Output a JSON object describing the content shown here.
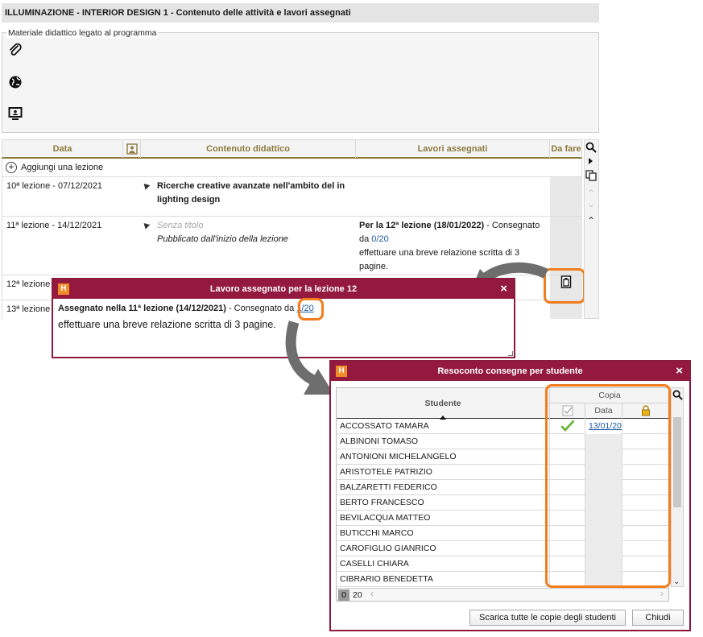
{
  "header": {
    "title": "ILLUMINAZIONE - INTERIOR DESIGN 1 - Contenuto delle attività e lavori assegnati"
  },
  "materials": {
    "legend": "Materiale didattico legato al programma",
    "icons": [
      "paperclip-icon",
      "globe-icon",
      "monitor-icon"
    ]
  },
  "table": {
    "columns": [
      "Data",
      "Contenuto didattico",
      "Lavori assegnati",
      "Da fare"
    ],
    "add_lesson": "Aggiungi una lezione",
    "rows": [
      {
        "date": "10ª lezione - 07/12/2021",
        "content_title": "Ricerche creative avanzate nell'ambito del in lighting design",
        "content_sub": "",
        "work_title": "",
        "work_delivered": "",
        "work_link": "",
        "work_text": ""
      },
      {
        "date": "11ª lezione - 14/12/2021",
        "content_title": "Senza titolo",
        "content_sub": "Pubblicato dall'inizio della lezione",
        "work_title": "Per la 12ª lezione (18/01/2022)",
        "work_delivered": " - Consegnato da ",
        "work_link": "0/20",
        "work_text": "effettuare una breve relazione scritta di 3 pagine."
      },
      {
        "date": "12ª lezione",
        "content_title": "",
        "content_sub": "",
        "work_title": "",
        "work_delivered": "",
        "work_link": "",
        "work_text": ""
      },
      {
        "date": "13ª lezione",
        "content_title": "",
        "content_sub": "",
        "work_title": "",
        "work_delivered": "",
        "work_link": "",
        "work_text": ""
      }
    ]
  },
  "dialog_assignment": {
    "title": "Lavoro assegnato per la lezione 12",
    "close": "×",
    "assigned": "Assegnato nella 11ª lezione (14/12/2021)",
    "delivered": " - Consegnato da ",
    "link": "1/20",
    "text": "effettuare una breve relazione scritta di 3 pagine."
  },
  "dialog_report": {
    "title": "Resoconto consegne per studente",
    "close": "×",
    "col_student": "Studente",
    "col_copy": "Copia",
    "col_date": "Data",
    "students": [
      {
        "name": "ACCOSSATO TAMARA",
        "delivered": true,
        "date": "13/01/20"
      },
      {
        "name": "ALBINONI TOMASO",
        "delivered": false,
        "date": ""
      },
      {
        "name": "ANTONIONI MICHELANGELO",
        "delivered": false,
        "date": ""
      },
      {
        "name": "ARISTOTELE PATRIZIO",
        "delivered": false,
        "date": ""
      },
      {
        "name": "BALZARETTI FEDERICO",
        "delivered": false,
        "date": ""
      },
      {
        "name": "BERTO FRANCESCO",
        "delivered": false,
        "date": ""
      },
      {
        "name": "BEVILACQUA MATTEO",
        "delivered": false,
        "date": ""
      },
      {
        "name": "BUTICCHI MARCO",
        "delivered": false,
        "date": ""
      },
      {
        "name": "CAROFIGLIO GIANRICO",
        "delivered": false,
        "date": ""
      },
      {
        "name": "CASELLI CHIARA",
        "delivered": false,
        "date": ""
      },
      {
        "name": "CIBRARIO BENEDETTA",
        "delivered": false,
        "date": ""
      }
    ],
    "count_selected": "0",
    "count_total": "20",
    "download_button": "Scarica tutte le copie degli studenti",
    "close_button": "Chiudi"
  },
  "colors": {
    "accent": "#94193f",
    "highlight": "#f07d1e",
    "header_text": "#8e7a3c",
    "link": "#1e5aa8"
  }
}
